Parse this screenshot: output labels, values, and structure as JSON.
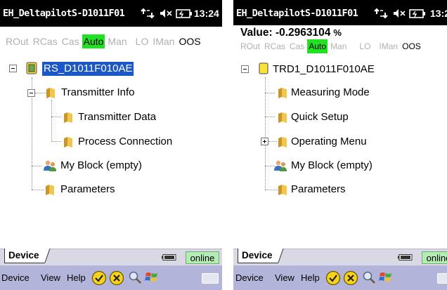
{
  "screens": [
    {
      "title": "EH_DeltapilotS-D1011F01",
      "clock": "13:24",
      "value_label": "",
      "value_unit": "",
      "modes": [
        "ROut",
        "RCas",
        "Cas",
        "Auto",
        "Man",
        "LO",
        "IMan",
        "OOS"
      ],
      "active_mode": "Auto",
      "tree": [
        {
          "label": "RS_D1011F010AE",
          "icon": "resource-block-icon",
          "selected": true
        },
        {
          "label": "Transmitter Info",
          "icon": "folder-icon"
        },
        {
          "label": "Transmitter Data",
          "icon": "folder-icon"
        },
        {
          "label": "Process Connection",
          "icon": "folder-icon"
        },
        {
          "label": "My Block (empty)",
          "icon": "users-icon"
        },
        {
          "label": "Parameters",
          "icon": "folder-icon"
        }
      ],
      "tab": "Device",
      "status": "online",
      "menu": [
        "Device",
        "View",
        "Help"
      ]
    },
    {
      "title": "EH_DeltapilotS-D1011F01",
      "clock": "13:2",
      "value_label": "Value: -0.2963104",
      "value_unit": "%",
      "modes": [
        "ROut",
        "RCas",
        "Cas",
        "Auto",
        "Man",
        "LO",
        "IMan",
        "OOS"
      ],
      "active_mode": "Auto",
      "tree": [
        {
          "label": "TRD1_D1011F010AE",
          "icon": "transducer-block-icon"
        },
        {
          "label": "Measuring Mode",
          "icon": "folder-icon"
        },
        {
          "label": "Quick Setup",
          "icon": "folder-icon"
        },
        {
          "label": "Operating Menu",
          "icon": "folder-icon"
        },
        {
          "label": "My Block (empty)",
          "icon": "users-icon"
        },
        {
          "label": "Parameters",
          "icon": "folder-icon"
        }
      ],
      "tab": "Device",
      "status": "online",
      "menu": [
        "Device",
        "View",
        "Help"
      ]
    }
  ],
  "icons": {
    "titlebar": [
      "connectivity-icon",
      "speaker-muted-icon",
      "battery-charging-icon"
    ],
    "menubar": [
      "ok-icon",
      "cancel-icon",
      "search-icon",
      "windows-start-icon",
      "keyboard-icon"
    ]
  },
  "colors": {
    "titlebar_bg": "#000000",
    "selection": "#1c57c6",
    "active_mode": "#22e022",
    "online_bg": "#b5ecb5",
    "menubar_bg": "#b3b4d9",
    "tabbar_bg": "#d9d8e4",
    "folder": "#e8b43a"
  }
}
